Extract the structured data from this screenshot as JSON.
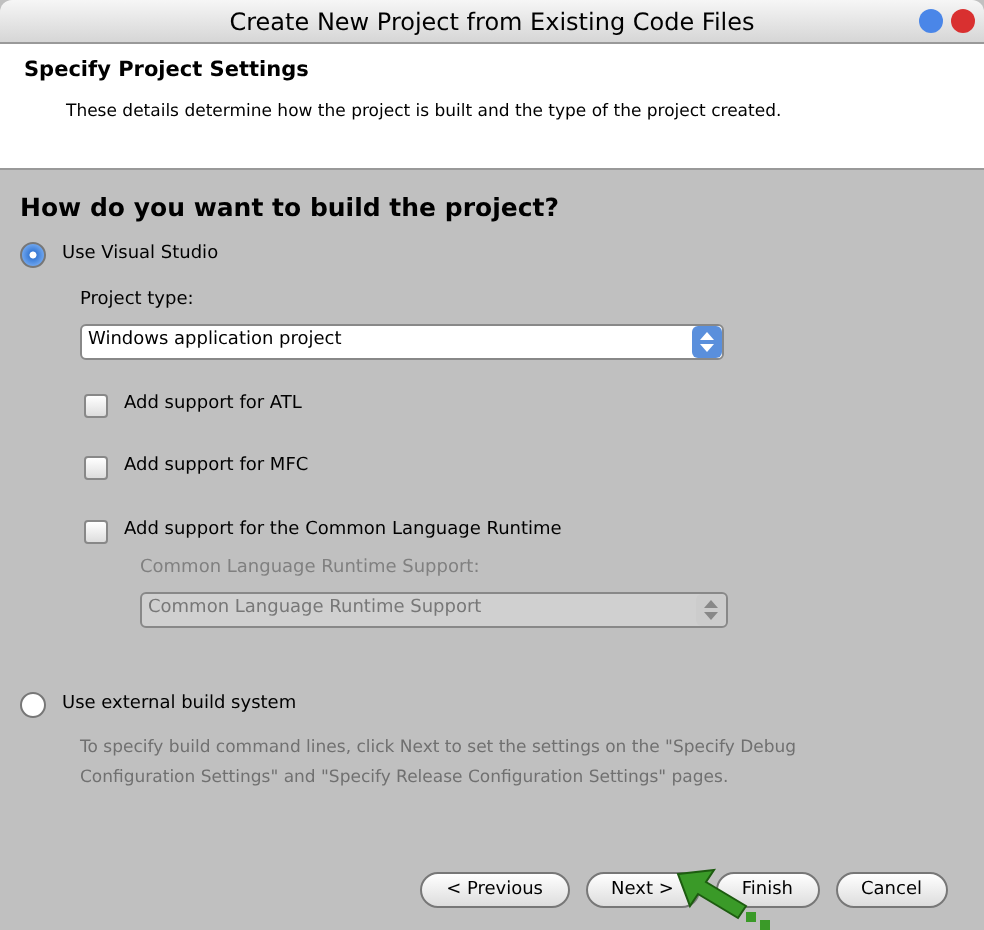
{
  "window": {
    "title": "Create New Project from Existing Code Files"
  },
  "header": {
    "title": "Specify Project Settings",
    "description": "These details determine how the project is built and the type of the project created."
  },
  "question": "How do you want to build the project?",
  "build_options": [
    {
      "label": "Use Visual Studio",
      "selected": true
    },
    {
      "label": "Use external build system",
      "selected": false
    }
  ],
  "project_type": {
    "label": "Project type:",
    "value": "Windows application project",
    "disabled": false
  },
  "checkboxes": [
    {
      "label": "Add support for ATL",
      "checked": false
    },
    {
      "label": "Add support for MFC",
      "checked": false
    },
    {
      "label": "Add support for the Common Language Runtime",
      "checked": false
    }
  ],
  "clr_support": {
    "label": "Common Language Runtime Support:",
    "value": "Common Language Runtime Support",
    "disabled": true
  },
  "external_note": "To specify build command lines, click Next to set the settings on the \"Specify Debug Configuration Settings\" and \"Specify Release Configuration Settings\" pages.",
  "buttons": [
    {
      "label": "< Previous"
    },
    {
      "label": "Next >"
    },
    {
      "label": "Finish"
    },
    {
      "label": "Cancel"
    }
  ]
}
